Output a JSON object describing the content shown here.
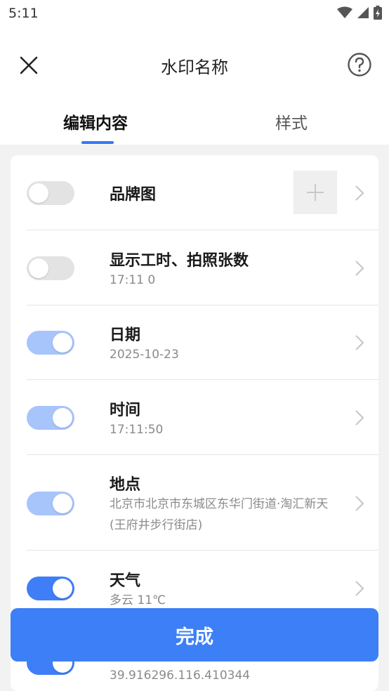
{
  "status_bar": {
    "time": "5:11"
  },
  "header": {
    "title": "水印名称",
    "close_icon": "close-icon",
    "help_icon": "help-icon"
  },
  "tabs": [
    {
      "label": "编辑内容",
      "active": true
    },
    {
      "label": "样式",
      "active": false
    }
  ],
  "items": [
    {
      "title": "品牌图",
      "subtitle": "",
      "enabled": false,
      "add_label": "+"
    },
    {
      "title": "显示工时、拍照张数",
      "subtitle": "17:11  0",
      "enabled": false
    },
    {
      "title": "日期",
      "subtitle": "2025-10-23",
      "enabled": true
    },
    {
      "title": "时间",
      "subtitle": "17:11:50",
      "enabled": true
    },
    {
      "title": "地点",
      "subtitle": "北京市北京市东城区东华门街道·淘汇新天(王府井步行街店)",
      "enabled": true
    },
    {
      "title": "天气",
      "subtitle": "多云 11℃",
      "enabled": true
    },
    {
      "title": "",
      "subtitle": "39.916296.116.410344",
      "enabled": true
    }
  ],
  "done_button": {
    "label": "完成"
  },
  "colors": {
    "accent": "#3c7ff7",
    "toggle_light": "#a7c4fb",
    "toggle_off": "#e3e3e3"
  }
}
